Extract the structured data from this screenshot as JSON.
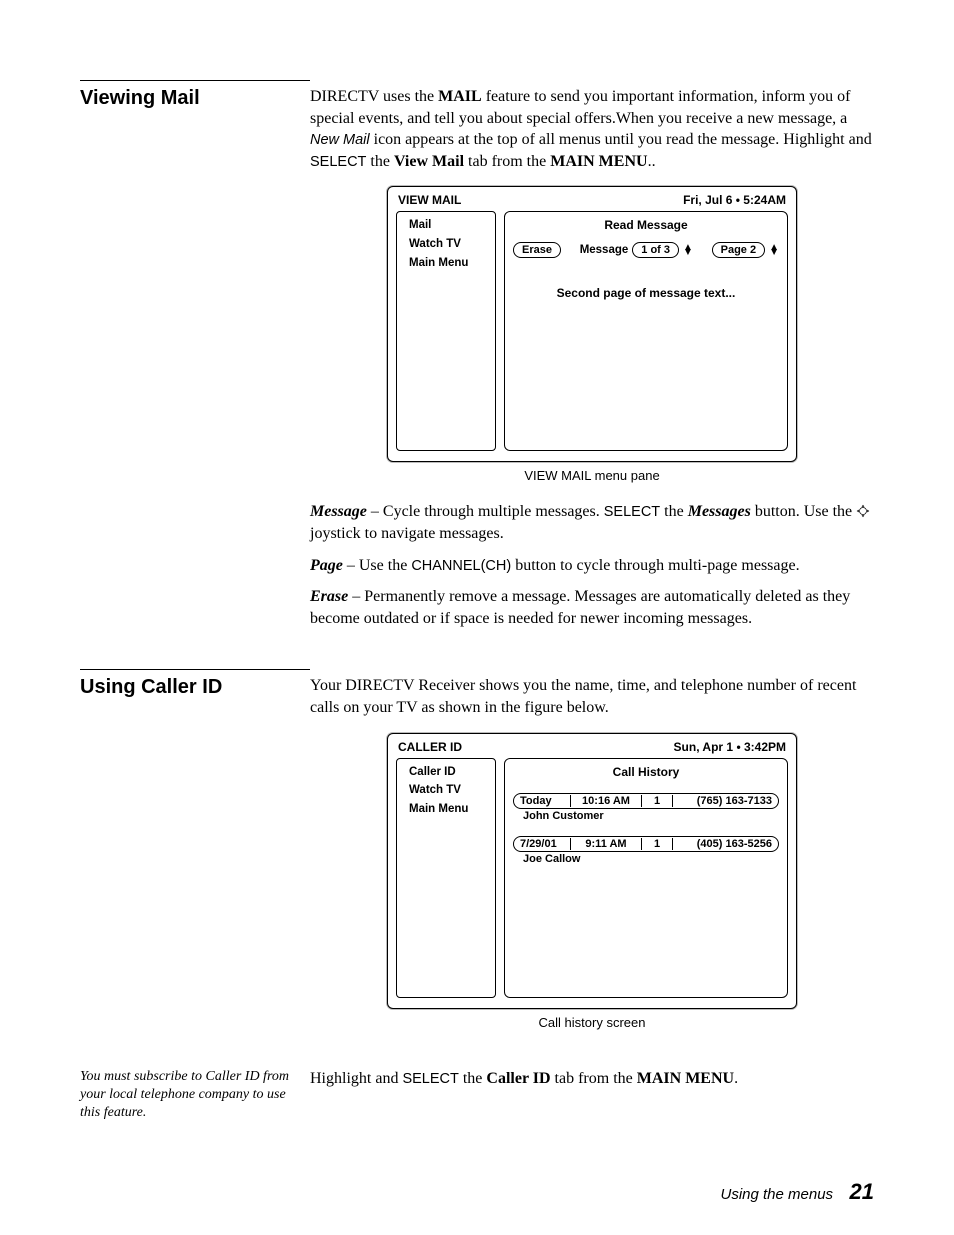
{
  "section1": {
    "heading": "Viewing Mail",
    "intro_parts": {
      "p1a": "DIRECTV uses the ",
      "p1b_bold": "MAIL",
      "p1c": " feature to send you important information, inform you of special events, and tell you about special offers.When you receive a new message, a ",
      "p1d_italic": "New Mail",
      "p1e": " icon appears at the top of all menus until you read the message. Highlight and ",
      "p1f_sans": "SELECT",
      "p1g": " the ",
      "p1h_bold": "View Mail",
      "p1i": " tab from the ",
      "p1j_bold": "MAIN MENU",
      "p1k": ".."
    },
    "panel": {
      "title_left": "VIEW MAIL",
      "title_right": "Fri, Jul 6  •  5:24AM",
      "sidebar": [
        "Mail",
        "Watch TV",
        "Main Menu"
      ],
      "main_heading": "Read Message",
      "erase": "Erase",
      "message_label": "Message",
      "message_count": "1 of 3",
      "page_label": "Page 2",
      "body_text": "Second page of message text..."
    },
    "caption": "VIEW MAIL menu pane",
    "msg_line": {
      "a_bi": "Message",
      "b": " – Cycle through multiple messages. ",
      "c_sans": "SELECT",
      "d": " the ",
      "e_bi": "Messages",
      "f": " button. Use the ",
      "g": "  joystick to navigate messages."
    },
    "page_line": {
      "a_bi": "Page",
      "b": " – Use the ",
      "c_sans": "CHANNEL(CH)",
      "d": " button to cycle through multi-page message."
    },
    "erase_line": {
      "a_bi": "Erase",
      "b": " – Permanently remove a message. Messages are automatically deleted as they become outdated or if space is needed for newer incoming messages."
    }
  },
  "section2": {
    "heading": "Using Caller ID",
    "intro": "Your DIRECTV Receiver shows you the name, time, and telephone number of recent calls on your TV as shown in the figure below.",
    "panel": {
      "title_left": "CALLER ID",
      "title_right": "Sun, Apr 1  •  3:42PM",
      "sidebar": [
        "Caller ID",
        "Watch TV",
        "Main Menu"
      ],
      "main_heading": "Call History",
      "rows": [
        {
          "date": "Today",
          "time": "10:16 AM",
          "count": "1",
          "phone": "(765) 163-7133",
          "name": "John Customer"
        },
        {
          "date": "7/29/01",
          "time": "9:11 AM",
          "count": "1",
          "phone": "(405) 163-5256",
          "name": "Joe Callow"
        }
      ]
    },
    "caption": "Call history screen",
    "sidenote": "You must subscribe to Caller ID from your local telephone company to use this feature.",
    "closing": {
      "a": "Highlight and ",
      "b_sans": "SELECT",
      "c": " the ",
      "d_bold": "Caller ID",
      "e": " tab from the ",
      "f_bold": "MAIN MENU",
      "g": "."
    }
  },
  "footer": {
    "text": "Using the menus",
    "page": "21"
  }
}
